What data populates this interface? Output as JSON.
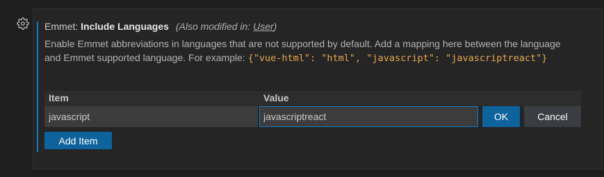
{
  "setting": {
    "category": "Emmet: ",
    "name": "Include Languages",
    "modified_prefix": "(Also modified in: ",
    "modified_link": "User",
    "modified_suffix": ")",
    "description_text": "Enable Emmet abbreviations in languages that are not supported by default. Add a mapping here between the language and Emmet supported language. For example: ",
    "description_example": "{\"vue-html\": \"html\", \"javascript\": \"javascriptreact\"}"
  },
  "table": {
    "header_item": "Item",
    "header_value": "Value",
    "row": {
      "item": "javascript",
      "value": "javascriptreact"
    }
  },
  "buttons": {
    "ok": "OK",
    "cancel": "Cancel",
    "add_item": "Add Item"
  },
  "icons": {
    "gear": "gear-icon"
  },
  "colors": {
    "accent": "#0e7ac4",
    "button": "#0e639c",
    "code": "#e8a84e",
    "background": "#1e1e1e",
    "panel": "#252526"
  }
}
